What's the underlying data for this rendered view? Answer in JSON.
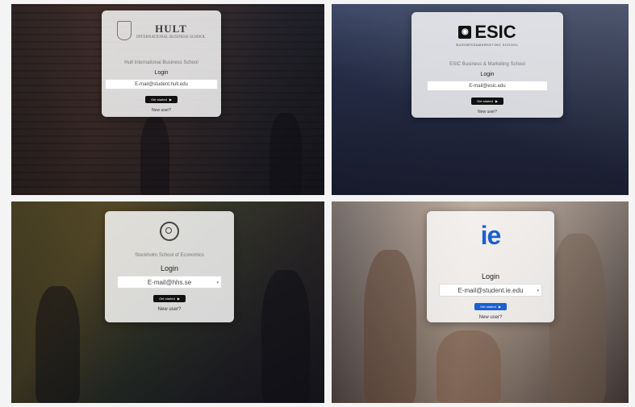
{
  "panels": [
    {
      "logo_text": "HULT",
      "logo_subtext": "INTERNATIONAL BUSINESS SCHOOL",
      "school_name": "Hult International Business School",
      "login_label": "Login",
      "email_value": "E-mail@student.hult.edu",
      "button_label": "Get started",
      "new_user_text": "New user?"
    },
    {
      "logo_text": "ESIC",
      "logo_subtext": "BUSINESS&MARKETING SCHOOL",
      "school_name": "ESIC Business & Marketing School",
      "login_label": "Login",
      "email_value": "E-mail@esic.edu",
      "button_label": "Get started",
      "new_user_text": "New user?"
    },
    {
      "school_name": "Stockholm School of Economics",
      "login_label": "Login",
      "email_value": "E-mail@hhs.se",
      "button_label": "Get started",
      "new_user_text": "New user?"
    },
    {
      "logo_text": "ie",
      "login_label": "Login",
      "email_value": "E-mail@student.ie.edu",
      "button_label": "Get started",
      "new_user_text": "New user?"
    }
  ],
  "colors": {
    "ie_brand": "#1b5fd0",
    "dark_button": "#111111"
  },
  "icons": {
    "button_arrow": "arrow-right-icon",
    "dropdown": "chevron-down-icon"
  }
}
